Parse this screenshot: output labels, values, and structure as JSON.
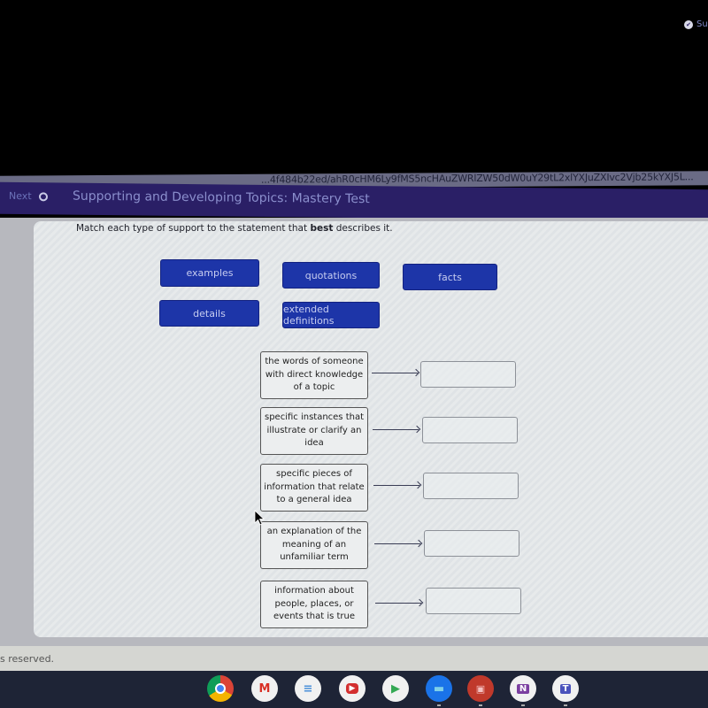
{
  "browser": {
    "url_fragment": "...4f484b22ed/ahR0cHM6Ly9fMS5ncHAuZWRlZW50dW0uY29tL2xlYXJuZXIvc2Vjb25kYXJ5L..."
  },
  "navbar": {
    "next_label": "Next",
    "title": "Supporting and Developing Topics: Mastery Test",
    "submit_label": "Su"
  },
  "question": {
    "instruction_pre": "Match each type of support to the statement that ",
    "instruction_bold": "best",
    "instruction_post": " describes it."
  },
  "chips": [
    {
      "label": "examples"
    },
    {
      "label": "quotations"
    },
    {
      "label": "facts"
    },
    {
      "label": "details"
    },
    {
      "label": "extended definitions"
    }
  ],
  "statements": [
    {
      "text": "the words of someone with direct knowledge of a topic",
      "answer": ""
    },
    {
      "text": "specific instances that illustrate or clarify an idea",
      "answer": ""
    },
    {
      "text": "specific pieces of information that relate to a general idea",
      "answer": ""
    },
    {
      "text": "an explanation of the meaning of an unfamiliar term",
      "answer": ""
    },
    {
      "text": "information about people, places, or events that is true",
      "answer": ""
    }
  ],
  "footer": {
    "copyright_fragment": "s reserved."
  },
  "shelf": {
    "apps": [
      {
        "name": "chrome",
        "glyph": "",
        "color": "#4285f4"
      },
      {
        "name": "gmail",
        "glyph": "M",
        "color": "#d93025"
      },
      {
        "name": "docs",
        "glyph": "≡",
        "color": "#4a90d9"
      },
      {
        "name": "youtube",
        "glyph": "▶",
        "color": "#d32f2f"
      },
      {
        "name": "play-store",
        "glyph": "▶",
        "color": "#34a853"
      },
      {
        "name": "files",
        "glyph": "▬",
        "color": "#1a73e8"
      },
      {
        "name": "gallery",
        "glyph": "▣",
        "color": "#c0392b"
      },
      {
        "name": "onenote",
        "glyph": "N",
        "color": "#7b3fa0"
      },
      {
        "name": "teams",
        "glyph": "T",
        "color": "#4b53bc"
      }
    ]
  }
}
